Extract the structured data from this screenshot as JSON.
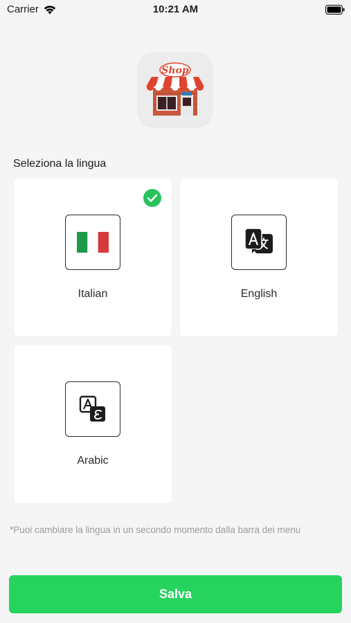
{
  "status_bar": {
    "carrier": "Carrier",
    "time": "10:21 AM"
  },
  "logo": {
    "sign_text": "Shop"
  },
  "language_section": {
    "title": "Seleziona la lingua",
    "options": [
      {
        "label": "Italian",
        "icon": "italy-flag-icon",
        "selected": true
      },
      {
        "label": "English",
        "icon": "translate-icon",
        "selected": false
      },
      {
        "label": "Arabic",
        "icon": "arabic-translate-icon",
        "selected": false
      }
    ]
  },
  "footnote": "*Puoi cambiare la lingua in un secondo momento dalla barra dei menu",
  "save_label": "Salva",
  "colors": {
    "accent": "#27d35f",
    "check": "#27c25b",
    "background": "#f5f5f5",
    "flag_green": "#1f9a4a",
    "flag_red": "#d63a3a"
  }
}
